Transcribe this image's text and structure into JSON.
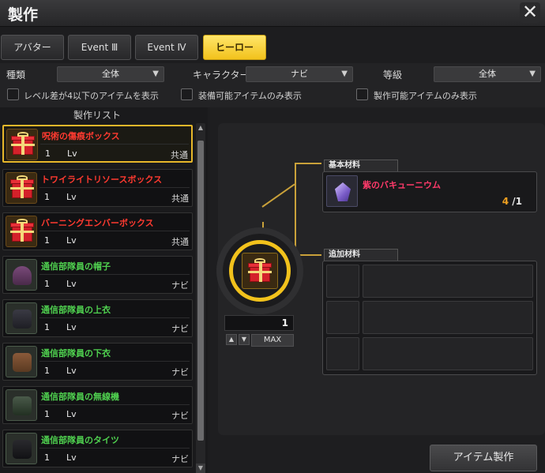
{
  "window": {
    "title": "製作",
    "close_icon": "close-icon"
  },
  "tabs": [
    {
      "label": "アバター",
      "active": false
    },
    {
      "label": "Event Ⅲ",
      "active": false
    },
    {
      "label": "Event Ⅳ",
      "active": false
    },
    {
      "label": "ヒーロー",
      "active": true
    }
  ],
  "filters": {
    "type_label": "種類",
    "type_value": "全体",
    "character_label": "キャラクター",
    "character_value": "ナビ",
    "grade_label": "等級",
    "grade_value": "全体",
    "check1": "レベル差が4以下のアイテムを表示",
    "check2": "装備可能アイテムのみ表示",
    "check3": "製作可能アイテムのみ表示"
  },
  "list": {
    "header": "製作リスト",
    "items": [
      {
        "name": "呪術の傷痕ボックス",
        "count": "1",
        "lv": "Lv",
        "class": "共通",
        "color": "#ff3a30",
        "icon": "gift-box-icon",
        "selected": true
      },
      {
        "name": "トワイライトリソースボックス",
        "count": "1",
        "lv": "Lv",
        "class": "共通",
        "color": "#ff3a30",
        "icon": "gift-box-icon",
        "selected": false
      },
      {
        "name": "バーニングエンバーボックス",
        "count": "1",
        "lv": "Lv",
        "class": "共通",
        "color": "#ff3a30",
        "icon": "gift-box-icon",
        "selected": false
      },
      {
        "name": "通信部隊員の帽子",
        "count": "1",
        "lv": "Lv",
        "class": "ナビ",
        "color": "#4fd04f",
        "icon": "hat-icon",
        "selected": false
      },
      {
        "name": "通信部隊員の上衣",
        "count": "1",
        "lv": "Lv",
        "class": "ナビ",
        "color": "#4fd04f",
        "icon": "top-icon",
        "selected": false
      },
      {
        "name": "通信部隊員の下衣",
        "count": "1",
        "lv": "Lv",
        "class": "ナビ",
        "color": "#4fd04f",
        "icon": "bottom-icon",
        "selected": false
      },
      {
        "name": "通信部隊員の無線機",
        "count": "1",
        "lv": "Lv",
        "class": "ナビ",
        "color": "#4fd04f",
        "icon": "radio-icon",
        "selected": false
      },
      {
        "name": "通信部隊員のタイツ",
        "count": "1",
        "lv": "Lv",
        "class": "ナビ",
        "color": "#4fd04f",
        "icon": "tights-icon",
        "selected": false
      }
    ]
  },
  "recipe": {
    "quantity": "1",
    "max_label": "MAX",
    "basic_label": "基本材料",
    "basic_material": {
      "name": "紫のバキューニウム",
      "have": "4",
      "need": "/1",
      "icon": "purple-crystal-icon"
    },
    "extra_label": "追加材料"
  },
  "craft_button": "アイテム製作"
}
